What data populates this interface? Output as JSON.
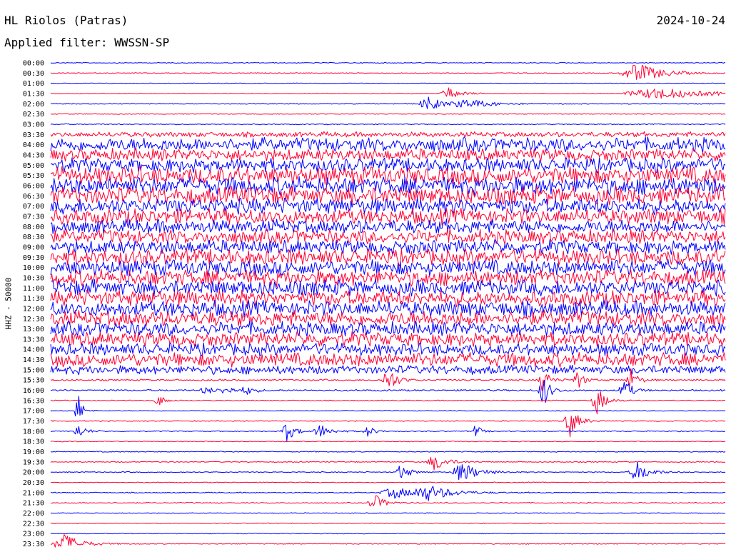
{
  "header": {
    "station": "HL Riolos (Patras)",
    "date": "2024-10-24",
    "filter": "Applied filter: WWSSN-SP"
  },
  "chart_data": {
    "type": "line",
    "title": "HL Riolos (Patras)",
    "subtitle": "Applied filter: WWSSN-SP",
    "date": "2024-10-24",
    "ylabel": "HHZ - 50000",
    "row_labels": [
      "00:00",
      "00:30",
      "01:00",
      "01:30",
      "02:00",
      "02:30",
      "03:00",
      "03:30",
      "04:00",
      "04:30",
      "05:00",
      "05:30",
      "06:00",
      "06:30",
      "07:00",
      "07:30",
      "08:00",
      "08:30",
      "09:00",
      "09:30",
      "10:00",
      "10:30",
      "11:00",
      "11:30",
      "12:00",
      "12:30",
      "13:00",
      "13:30",
      "14:00",
      "14:30",
      "15:00",
      "15:30",
      "16:00",
      "16:30",
      "17:00",
      "17:30",
      "18:00",
      "18:30",
      "19:00",
      "19:30",
      "20:00",
      "20:30",
      "21:00",
      "21:30",
      "22:00",
      "22:30",
      "23:00",
      "23:30"
    ],
    "trace_colors": [
      "#0000ff",
      "#ff0033"
    ],
    "noise_level": [
      0.5,
      0.5,
      0.4,
      0.5,
      0.6,
      0.5,
      0.6,
      3,
      8,
      7,
      8,
      10,
      10,
      10,
      9,
      9,
      8,
      8,
      8,
      9,
      9,
      9,
      9,
      9,
      9,
      9,
      8,
      8,
      7,
      8,
      5,
      1,
      1,
      0.6,
      0.5,
      0.6,
      0.6,
      0.5,
      0.6,
      0.6,
      0.6,
      0.5,
      0.6,
      0.6,
      0.5,
      0.5,
      0.5,
      0.6
    ],
    "events": [
      {
        "row": 1,
        "t": 0.87,
        "amp": 14,
        "width": 0.03
      },
      {
        "row": 3,
        "t": 0.59,
        "amp": 8,
        "width": 0.015
      },
      {
        "row": 3,
        "t": 0.9,
        "amp": 8,
        "width": 0.06
      },
      {
        "row": 4,
        "t": 0.56,
        "amp": 9,
        "width": 0.02
      },
      {
        "row": 4,
        "t": 0.62,
        "amp": 6,
        "width": 0.03
      },
      {
        "row": 31,
        "t": 0.5,
        "amp": 20,
        "width": 0.01
      },
      {
        "row": 31,
        "t": 0.73,
        "amp": 18,
        "width": 0.008
      },
      {
        "row": 31,
        "t": 0.78,
        "amp": 14,
        "width": 0.008
      },
      {
        "row": 31,
        "t": 0.86,
        "amp": 16,
        "width": 0.008
      },
      {
        "row": 32,
        "t": 0.23,
        "amp": 6,
        "width": 0.01
      },
      {
        "row": 32,
        "t": 0.26,
        "amp": 6,
        "width": 0.01
      },
      {
        "row": 32,
        "t": 0.29,
        "amp": 6,
        "width": 0.01
      },
      {
        "row": 32,
        "t": 0.73,
        "amp": 24,
        "width": 0.008
      },
      {
        "row": 32,
        "t": 0.85,
        "amp": 20,
        "width": 0.008
      },
      {
        "row": 33,
        "t": 0.16,
        "amp": 8,
        "width": 0.008
      },
      {
        "row": 33,
        "t": 0.81,
        "amp": 20,
        "width": 0.01
      },
      {
        "row": 34,
        "t": 0.04,
        "amp": 30,
        "width": 0.005
      },
      {
        "row": 35,
        "t": 0.77,
        "amp": 22,
        "width": 0.01
      },
      {
        "row": 36,
        "t": 0.04,
        "amp": 10,
        "width": 0.01
      },
      {
        "row": 36,
        "t": 0.35,
        "amp": 14,
        "width": 0.01
      },
      {
        "row": 36,
        "t": 0.4,
        "amp": 10,
        "width": 0.012
      },
      {
        "row": 36,
        "t": 0.47,
        "amp": 8,
        "width": 0.008
      },
      {
        "row": 36,
        "t": 0.63,
        "amp": 10,
        "width": 0.006
      },
      {
        "row": 39,
        "t": 0.57,
        "amp": 12,
        "width": 0.015
      },
      {
        "row": 40,
        "t": 0.52,
        "amp": 12,
        "width": 0.01
      },
      {
        "row": 40,
        "t": 0.61,
        "amp": 14,
        "width": 0.02
      },
      {
        "row": 40,
        "t": 0.87,
        "amp": 14,
        "width": 0.015
      },
      {
        "row": 42,
        "t": 0.51,
        "amp": 8,
        "width": 0.025
      },
      {
        "row": 42,
        "t": 0.56,
        "amp": 10,
        "width": 0.03
      },
      {
        "row": 43,
        "t": 0.48,
        "amp": 12,
        "width": 0.012
      },
      {
        "row": 47,
        "t": 0.02,
        "amp": 14,
        "width": 0.02
      }
    ]
  }
}
